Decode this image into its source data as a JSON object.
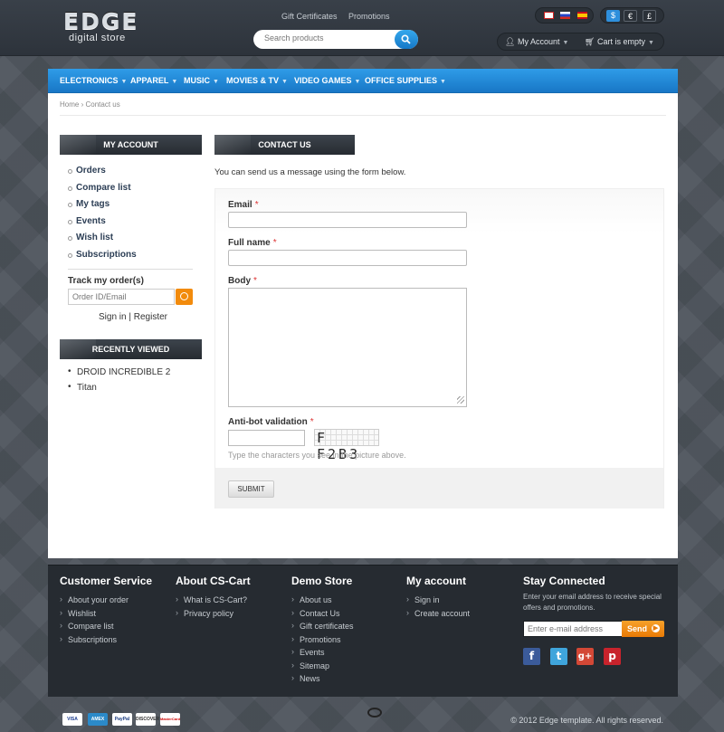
{
  "logo": {
    "title": "EDGE",
    "subtitle": "digital store"
  },
  "top_links": [
    "Gift Certificates",
    "Promotions"
  ],
  "search": {
    "placeholder": "Search products"
  },
  "currencies": [
    "$",
    "€",
    "£"
  ],
  "account": {
    "label": "My Account",
    "cart_label": "Cart is empty"
  },
  "nav": [
    "ELECTRONICS",
    "APPAREL",
    "MUSIC",
    "MOVIES & TV",
    "VIDEO GAMES",
    "OFFICE SUPPLIES"
  ],
  "breadcrumb": {
    "home": "Home",
    "separator": "›",
    "current": "Contact us"
  },
  "sidebar": {
    "my_account_title": "MY ACCOUNT",
    "items": [
      "Orders",
      "Compare list",
      "My tags",
      "Events",
      "Wish list",
      "Subscriptions"
    ],
    "track_title": "Track my order(s)",
    "track_placeholder": "Order ID/Email",
    "sign_in": "Sign in",
    "separator": "|",
    "register": "Register",
    "recent_title": "RECENTLY VIEWED",
    "recent_items": [
      "DROID INCREDIBLE 2",
      "Titan"
    ]
  },
  "contact": {
    "title": "CONTACT US",
    "intro": "You can send us a message using the form below.",
    "required_mark": "*",
    "email_label": "Email",
    "fullname_label": "Full name",
    "body_label": "Body",
    "antibot_label": "Anti-bot validation",
    "captcha_text": "F F2B3",
    "captcha_hint": "Type the characters you see in the picture above.",
    "submit": "Submit"
  },
  "footer": {
    "customer_service": {
      "title": "Customer Service",
      "items": [
        "About your order",
        "Wishlist",
        "Compare list",
        "Subscriptions"
      ]
    },
    "about": {
      "title": "About CS-Cart",
      "items": [
        "What is CS-Cart?",
        "Privacy policy"
      ]
    },
    "demo_store": {
      "title": "Demo Store",
      "items": [
        "About us",
        "Contact Us",
        "Gift certificates",
        "Promotions",
        "Events",
        "Sitemap",
        "News"
      ]
    },
    "my_account": {
      "title": "My account",
      "items": [
        "Sign in",
        "Create account"
      ]
    },
    "stay_connected": {
      "title": "Stay Connected",
      "text": "Enter your email address to receive special offers and promotions.",
      "placeholder": "Enter e-mail address",
      "send": "Send"
    }
  },
  "payments": [
    "VISA",
    "AMEX",
    "PayPal",
    "DISCOVER",
    "MasterCard"
  ],
  "copyright": "© 2012 Edge template. All rights reserved.",
  "colors": {
    "accent_blue": "#1f87d6",
    "orange": "#f28b0c",
    "footer_bg": "#262b31"
  }
}
